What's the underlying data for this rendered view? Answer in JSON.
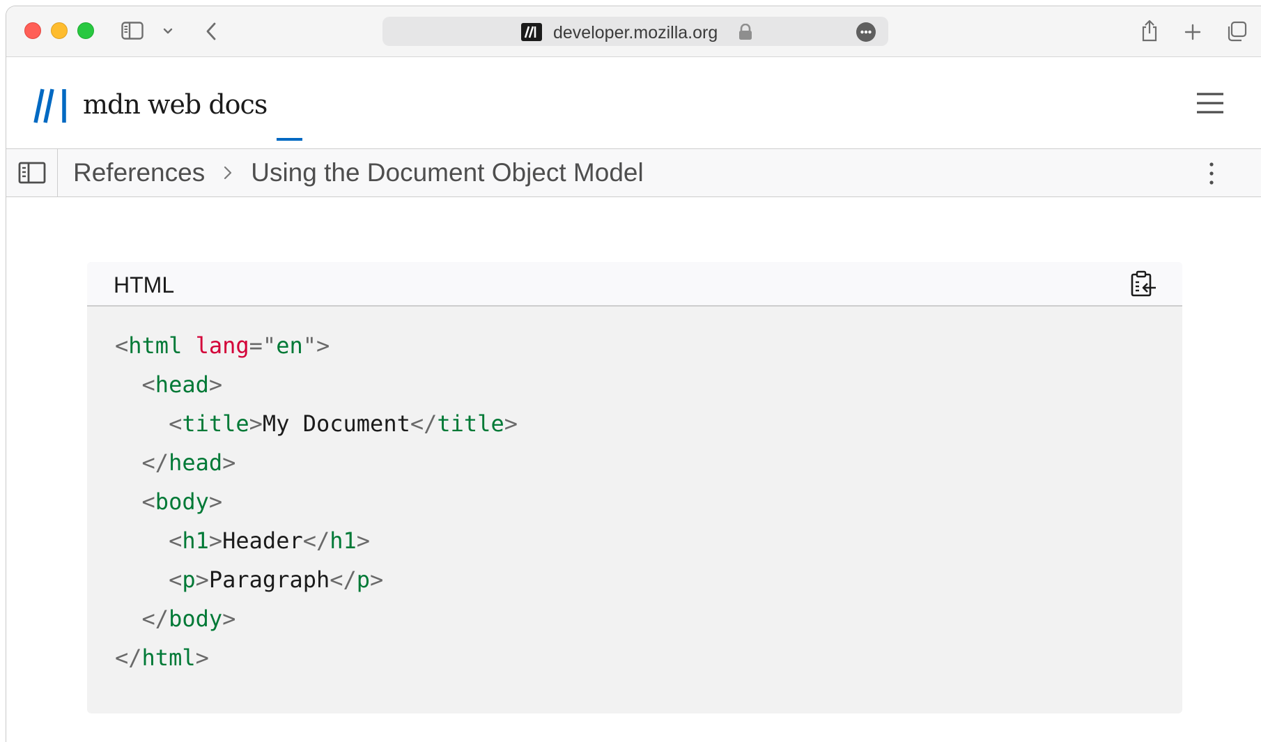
{
  "browser": {
    "url": "developer.mozilla.org"
  },
  "site": {
    "logo_text": "mdn web docs"
  },
  "breadcrumb": {
    "items": [
      "References",
      "Using the Document Object Model"
    ]
  },
  "code_example": {
    "language": "HTML",
    "lines": [
      [
        {
          "t": "punct",
          "v": "<"
        },
        {
          "t": "tag",
          "v": "html"
        },
        {
          "t": "text",
          "v": " "
        },
        {
          "t": "attr",
          "v": "lang"
        },
        {
          "t": "punct",
          "v": "=\""
        },
        {
          "t": "str",
          "v": "en"
        },
        {
          "t": "punct",
          "v": "\">"
        }
      ],
      [
        {
          "t": "text",
          "v": "  "
        },
        {
          "t": "punct",
          "v": "<"
        },
        {
          "t": "tag",
          "v": "head"
        },
        {
          "t": "punct",
          "v": ">"
        }
      ],
      [
        {
          "t": "text",
          "v": "    "
        },
        {
          "t": "punct",
          "v": "<"
        },
        {
          "t": "tag",
          "v": "title"
        },
        {
          "t": "punct",
          "v": ">"
        },
        {
          "t": "text",
          "v": "My Document"
        },
        {
          "t": "punct",
          "v": "</"
        },
        {
          "t": "tag",
          "v": "title"
        },
        {
          "t": "punct",
          "v": ">"
        }
      ],
      [
        {
          "t": "text",
          "v": "  "
        },
        {
          "t": "punct",
          "v": "</"
        },
        {
          "t": "tag",
          "v": "head"
        },
        {
          "t": "punct",
          "v": ">"
        }
      ],
      [
        {
          "t": "text",
          "v": "  "
        },
        {
          "t": "punct",
          "v": "<"
        },
        {
          "t": "tag",
          "v": "body"
        },
        {
          "t": "punct",
          "v": ">"
        }
      ],
      [
        {
          "t": "text",
          "v": "    "
        },
        {
          "t": "punct",
          "v": "<"
        },
        {
          "t": "tag",
          "v": "h1"
        },
        {
          "t": "punct",
          "v": ">"
        },
        {
          "t": "text",
          "v": "Header"
        },
        {
          "t": "punct",
          "v": "</"
        },
        {
          "t": "tag",
          "v": "h1"
        },
        {
          "t": "punct",
          "v": ">"
        }
      ],
      [
        {
          "t": "text",
          "v": "    "
        },
        {
          "t": "punct",
          "v": "<"
        },
        {
          "t": "tag",
          "v": "p"
        },
        {
          "t": "punct",
          "v": ">"
        },
        {
          "t": "text",
          "v": "Paragraph"
        },
        {
          "t": "punct",
          "v": "</"
        },
        {
          "t": "tag",
          "v": "p"
        },
        {
          "t": "punct",
          "v": ">"
        }
      ],
      [
        {
          "t": "text",
          "v": "  "
        },
        {
          "t": "punct",
          "v": "</"
        },
        {
          "t": "tag",
          "v": "body"
        },
        {
          "t": "punct",
          "v": ">"
        }
      ],
      [
        {
          "t": "punct",
          "v": "</"
        },
        {
          "t": "tag",
          "v": "html"
        },
        {
          "t": "punct",
          "v": ">"
        }
      ]
    ]
  },
  "icons": {
    "toolbar": [
      "sidebar-icon",
      "chevron-down-icon",
      "back-icon",
      "share-icon",
      "new-tab-icon",
      "tab-overview-icon"
    ],
    "url": [
      "site-favicon-icon",
      "lock-icon",
      "page-menu-icon"
    ],
    "page": [
      "mdn-logo-icon",
      "hamburger-menu-icon",
      "sidebar-toggle-icon",
      "chevron-right-icon",
      "kebab-menu-icon",
      "copy-clipboard-icon"
    ]
  },
  "colors": {
    "accent": "#0069c2",
    "code_tag": "#007936",
    "code_attr": "#d30038",
    "code_punct": "#696969"
  }
}
